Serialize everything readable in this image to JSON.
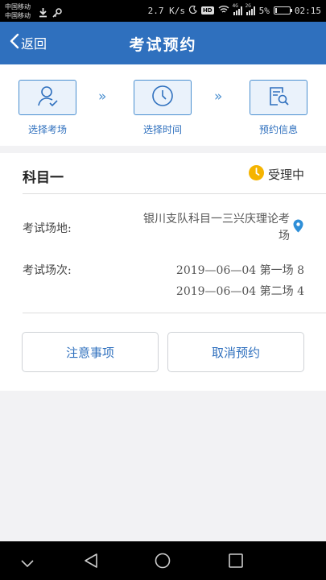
{
  "status_bar": {
    "carrier_1": "中国移动",
    "carrier_2": "中国移动",
    "speed": "2.7 K/s",
    "hd": "HD",
    "net_1": "4G",
    "net_2": "2G",
    "battery": "5%",
    "time": "02:15"
  },
  "header": {
    "back_label": "返回",
    "title": "考试预约"
  },
  "steps": [
    {
      "label": "选择考场",
      "icon": "person-check-icon"
    },
    {
      "label": "选择时间",
      "icon": "clock-icon"
    },
    {
      "label": "预约信息",
      "icon": "document-search-icon"
    }
  ],
  "card": {
    "subject": "科目一",
    "status": "受理中",
    "venue_label": "考试场地:",
    "venue_line_1": "银川支队科目一三兴庆理论考",
    "venue_line_2": "场",
    "session_label": "考试场次:",
    "sessions": [
      "2019—06—04  第一场  8",
      "2019—06—04  第二场  4"
    ],
    "notes_button": "注意事项",
    "cancel_button": "取消预约"
  },
  "colors": {
    "primary": "#2f70be",
    "status_icon": "#f5b400",
    "pin": "#2f8fd8"
  }
}
